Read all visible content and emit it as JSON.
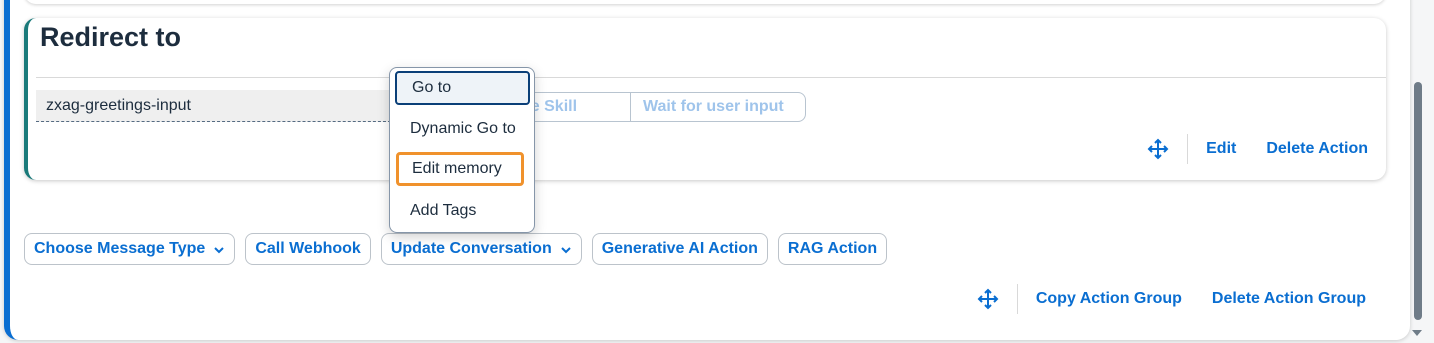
{
  "action_card": {
    "title": "Redirect to",
    "target_input_value": "zxag-greetings-input",
    "segment_skill_label": "he Skill",
    "segment_wait_label": "Wait for user input",
    "edit_label": "Edit",
    "delete_label": "Delete Action"
  },
  "dropdown_menu": {
    "items": [
      "Go to",
      "Dynamic Go to",
      "Edit memory",
      "Add Tags"
    ]
  },
  "action_types": {
    "choose_message_type": "Choose Message Type",
    "call_webhook": "Call Webhook",
    "update_conversation": "Update Conversation",
    "generative_ai_action": "Generative AI Action",
    "rag_action": "RAG Action"
  },
  "group_tools": {
    "copy_label": "Copy Action Group",
    "delete_label": "Delete Action Group"
  },
  "colors": {
    "accent": "#0a6ed1",
    "card_accent": "#1a7a7a",
    "highlight": "#f0922c"
  },
  "icons": [
    "move-icon",
    "chevron-down-icon"
  ]
}
